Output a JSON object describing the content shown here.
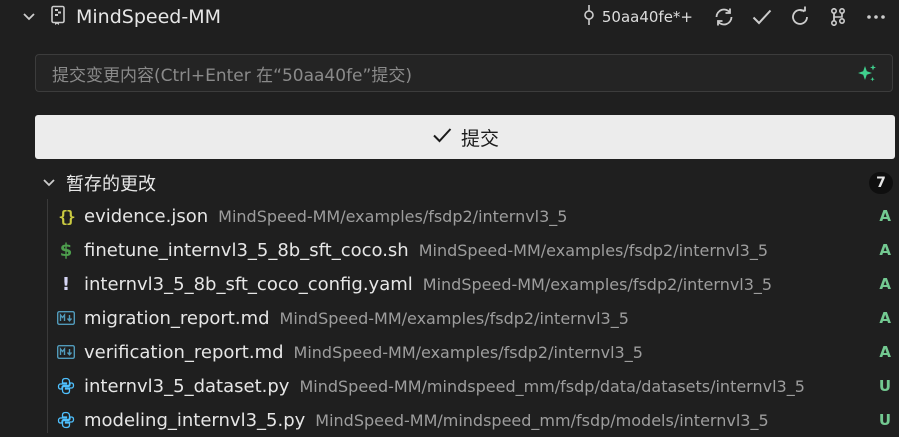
{
  "repo": {
    "title": "MindSpeed-MM"
  },
  "toolbar": {
    "branch": "50aa40fe*+"
  },
  "commit": {
    "placeholder": "提交变更内容(Ctrl+Enter 在“50aa40fe”提交)",
    "button_label": "提交"
  },
  "staged": {
    "title": "暂存的更改",
    "count": "7",
    "files": [
      {
        "name": "evidence.json",
        "path": "MindSpeed-MM/examples/fsdp2/internvl3_5",
        "status": "A",
        "icon": "json-icon"
      },
      {
        "name": "finetune_internvl3_5_8b_sft_coco.sh",
        "path": "MindSpeed-MM/examples/fsdp2/internvl3_5",
        "status": "A",
        "icon": "shell-icon"
      },
      {
        "name": "internvl3_5_8b_sft_coco_config.yaml",
        "path": "MindSpeed-MM/examples/fsdp2/internvl3_5",
        "status": "A",
        "icon": "yaml-icon"
      },
      {
        "name": "migration_report.md",
        "path": "MindSpeed-MM/examples/fsdp2/internvl3_5",
        "status": "A",
        "icon": "markdown-icon"
      },
      {
        "name": "verification_report.md",
        "path": "MindSpeed-MM/examples/fsdp2/internvl3_5",
        "status": "A",
        "icon": "markdown-icon"
      },
      {
        "name": "internvl3_5_dataset.py",
        "path": "MindSpeed-MM/mindspeed_mm/fsdp/data/datasets/internvl3_5",
        "status": "U",
        "icon": "python-icon"
      },
      {
        "name": "modeling_internvl3_5.py",
        "path": "MindSpeed-MM/mindspeed_mm/fsdp/models/internvl3_5",
        "status": "U",
        "icon": "python-icon"
      }
    ]
  },
  "colors": {
    "background": "#1f1f1f",
    "added": "#73c991",
    "untracked": "#73c991",
    "json_icon": "#cbcb41",
    "shell_icon": "#4d9e4d",
    "yaml_icon": "#d6d6f5",
    "markdown_icon": "#519aba",
    "python_icon": "#4fc1ff",
    "sparkle": "#3fd18e"
  }
}
